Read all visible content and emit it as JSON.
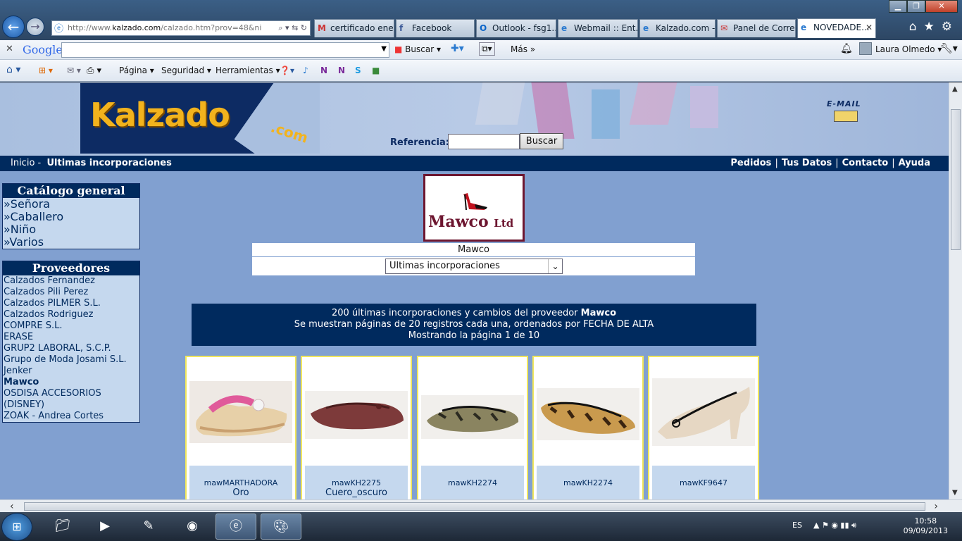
{
  "browser": {
    "url_prefix": "http://www.",
    "url_domain": "kalzado.com",
    "url_rest": "/calzado.htm?prov=48&ni",
    "tabs": [
      {
        "label": "certificado ene...",
        "icon": "gmail-icon",
        "active": false
      },
      {
        "label": "Facebook",
        "icon": "facebook-icon",
        "active": false
      },
      {
        "label": "Outlook - fsg1...",
        "icon": "outlook-icon",
        "active": false
      },
      {
        "label": "Webmail :: Ent...",
        "icon": "ie-icon",
        "active": false
      },
      {
        "label": "Kalzado.com - ...",
        "icon": "ie-icon",
        "active": false
      },
      {
        "label": "Panel de Corre...",
        "icon": "mail-icon",
        "active": false
      },
      {
        "label": "NOVEDADE...",
        "icon": "ie-icon",
        "active": true
      }
    ]
  },
  "google_bar": {
    "logo": "Google",
    "search_label": "Buscar",
    "more_label": "Más",
    "user": "Laura Olmedo"
  },
  "command_bar": {
    "page": "Página",
    "security": "Seguridad",
    "tools": "Herramientas"
  },
  "site": {
    "logo_text": "Kalzado",
    "logo_suffix": ".com",
    "ref_label": "Referencia:",
    "ref_button": "Buscar",
    "email_label": "E-MAIL",
    "nav_home": "Inicio -",
    "nav_current": "Ultimas incorporaciones",
    "nav_links": [
      "Pedidos",
      "Tus Datos",
      "Contacto",
      "Ayuda"
    ]
  },
  "sidebar": {
    "catalog_title": "Catálogo general",
    "catalog_items": [
      "»Señora",
      "»Caballero",
      "»Niño",
      "»Varios"
    ],
    "providers_title": "Proveedores",
    "providers": [
      "Calzados Fernandez",
      "Calzados Pili Perez",
      "Calzados PILMER S.L.",
      "Calzados Rodriguez",
      "COMPRE S.L.",
      "ERASE",
      "GRUP2 LABORAL, S.C.P.",
      "Grupo de Moda Josami S.L.",
      "Jenker",
      "Mawco",
      "OSDISA ACCESORIOS",
      "(DISNEY)",
      "ZOAK - Andrea Cortes"
    ],
    "selected_provider": "Mawco"
  },
  "main": {
    "provider_logo_text": "Mawco",
    "provider_logo_suffix": "Ltd",
    "provider_name": "Mawco",
    "select_value": "Ultimas incorporaciones",
    "info_line1_pre": "200 últimas incorporaciones y cambios del proveedor ",
    "info_line1_bold": "Mawco",
    "info_line2": "Se muestran páginas de 20 registros cada una, ordenados por FECHA DE ALTA",
    "info_line3": "Mostrando la página 1 de 10",
    "products": [
      {
        "code": "mawMARTHADORA",
        "color": "Oro"
      },
      {
        "code": "mawKH2275",
        "color": "Cuero_oscuro"
      },
      {
        "code": "mawKH2274",
        "color": ""
      },
      {
        "code": "mawKH2274",
        "color": ""
      },
      {
        "code": "mawKF9647",
        "color": ""
      }
    ]
  },
  "taskbar": {
    "lang": "ES",
    "time": "10:58",
    "date": "09/09/2013"
  }
}
